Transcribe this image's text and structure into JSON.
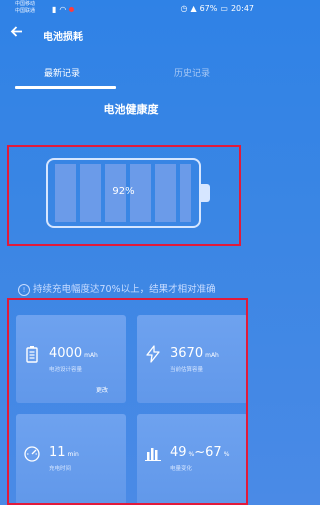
{
  "status_bar": {
    "carrier_line1": "中国移动",
    "carrier_line2": "中国联通",
    "battery_percent": "67%",
    "time": "20:47"
  },
  "app_bar": {
    "title": "电池损耗"
  },
  "tabs": [
    {
      "label": "最新记录",
      "active": true
    },
    {
      "label": "历史记录",
      "active": false
    }
  ],
  "health": {
    "title": "电池健康度",
    "percent": "92%"
  },
  "notice": "持续充电幅度达70%以上，结果才相对准确",
  "cards": [
    {
      "value": "4000",
      "unit": "mAh",
      "label": "电池设计容量",
      "action": "更改",
      "icon": "battery-icon"
    },
    {
      "value": "3670",
      "unit": "mAh",
      "label": "当前估算容量",
      "icon": "lightning-icon"
    },
    {
      "value": "11",
      "unit": "min",
      "label": "充电时间",
      "icon": "speedometer-icon"
    },
    {
      "value": "49",
      "unit": "%",
      "value2": "67",
      "unit2": "%",
      "label": "电量变化",
      "icon": "bar-chart-icon"
    }
  ],
  "colors": {
    "background": "#3b86e4",
    "highlight_box": "#e21a3a",
    "card": "#6ea2ef"
  }
}
